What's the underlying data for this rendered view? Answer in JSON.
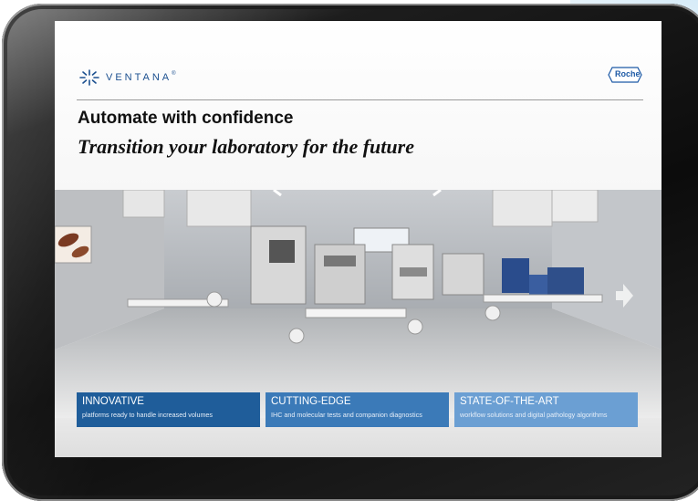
{
  "brand": {
    "product_logo_text": "VENTANA",
    "product_logo_mark": "®",
    "company_logo_text": "Roche"
  },
  "hero": {
    "headline": "Automate with confidence",
    "subheadline": "Transition your laboratory for the future"
  },
  "features": [
    {
      "title": "INNOVATIVE",
      "subtitle": "platforms ready to handle increased volumes"
    },
    {
      "title": "CUTTING-EDGE",
      "subtitle": "IHC and molecular tests and companion diagnostics"
    },
    {
      "title": "STATE-OF-THE-ART",
      "subtitle": "workflow solutions and digital pathology algorithms"
    }
  ],
  "navigation": {
    "next_icon": "arrow-right-icon"
  },
  "colors": {
    "feature_1": "#1f5d9a",
    "feature_2": "#3b7ab8",
    "feature_3": "#6b9fd3",
    "brand_blue": "#1b4f8f"
  }
}
